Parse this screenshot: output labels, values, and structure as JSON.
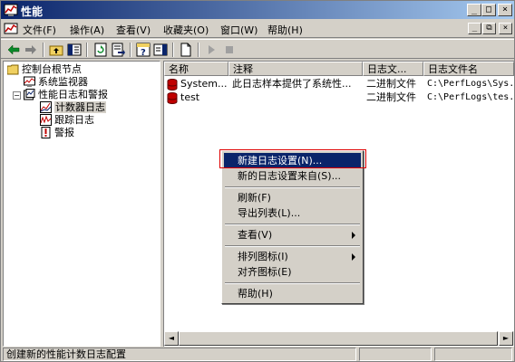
{
  "window": {
    "title": "性能"
  },
  "menubar": {
    "items": [
      "文件(F)",
      "操作(A)",
      "查看(V)",
      "收藏夹(O)",
      "窗口(W)",
      "帮助(H)"
    ]
  },
  "title_buttons": {
    "minimize": "_",
    "maximize": "□",
    "close": "×"
  },
  "mdi_buttons": {
    "minimize": "_",
    "restore": "⧉",
    "close": "×"
  },
  "toolbar": {
    "back_icon": "back-arrow-icon",
    "forward_icon": "forward-arrow-icon"
  },
  "tree": {
    "items": [
      {
        "label": "控制台根节点"
      },
      {
        "label": "系统监视器"
      },
      {
        "label": "性能日志和警报"
      },
      {
        "label": "计数器日志"
      },
      {
        "label": "跟踪日志"
      },
      {
        "label": "警报"
      }
    ],
    "expander_minus": "−"
  },
  "list": {
    "columns": [
      "名称",
      "注释",
      "日志文...",
      "日志文件名"
    ],
    "rows": [
      {
        "name": "System...",
        "comment": "此日志样本提供了系统性...",
        "type": "二进制文件",
        "file": "C:\\PerfLogs\\Sys..."
      },
      {
        "name": "test",
        "comment": "",
        "type": "二进制文件",
        "file": "C:\\PerfLogs\\tes..."
      }
    ]
  },
  "scrollbar": {
    "left": "◄",
    "right": "►"
  },
  "status": {
    "text": "创建新的性能计数日志配置"
  },
  "context_menu": {
    "items": [
      {
        "label": "新建日志设置(N)..."
      },
      {
        "label": "新的日志设置来自(S)..."
      },
      {
        "label": "刷新(F)"
      },
      {
        "label": "导出列表(L)..."
      },
      {
        "label": "查看(V)"
      },
      {
        "label": "排列图标(I)"
      },
      {
        "label": "对齐图标(E)"
      },
      {
        "label": "帮助(H)"
      }
    ]
  },
  "colors": {
    "title_bar": "#0a246a",
    "highlight": "#0a246a",
    "db_icon": "#c00000",
    "focus_ring": "#e00000"
  }
}
